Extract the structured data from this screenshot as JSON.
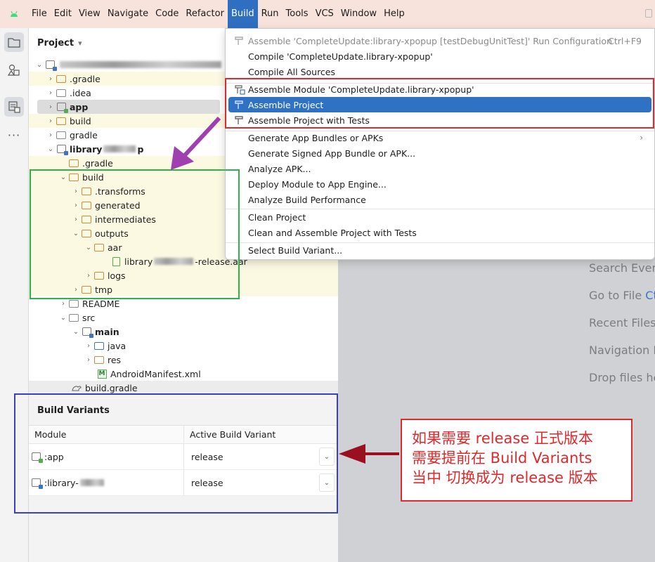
{
  "menubar": {
    "items": [
      "File",
      "Edit",
      "View",
      "Navigate",
      "Code",
      "Refactor",
      "Build",
      "Run",
      "Tools",
      "VCS",
      "Window",
      "Help"
    ],
    "active": "Build"
  },
  "project_panel": {
    "title": "Project",
    "tree": [
      {
        "label": "",
        "blurred": true
      },
      {
        "label": ".gradle"
      },
      {
        "label": ".idea"
      },
      {
        "label": "app"
      },
      {
        "label": "build"
      },
      {
        "label": "gradle"
      },
      {
        "label": "library",
        "blurred_suffix": true
      },
      {
        "label": ".gradle"
      },
      {
        "label": "build"
      },
      {
        "label": ".transforms"
      },
      {
        "label": "generated"
      },
      {
        "label": "intermediates"
      },
      {
        "label": "outputs"
      },
      {
        "label": "aar"
      },
      {
        "label": "library",
        "suffix": "-release.aar"
      },
      {
        "label": "logs"
      },
      {
        "label": "tmp"
      },
      {
        "label": "README"
      },
      {
        "label": "src"
      },
      {
        "label": "main"
      },
      {
        "label": "java"
      },
      {
        "label": "res"
      },
      {
        "label": "AndroidManifest.xml"
      },
      {
        "label": "build.gradle"
      }
    ]
  },
  "build_menu": {
    "items": [
      {
        "label": "Assemble 'CompleteUpdate:library-xpopup [testDebugUnitTest]' Run Configuration",
        "shortcut": "Ctrl+F9",
        "disabled": true
      },
      {
        "label": "Compile 'CompleteUpdate.library-xpopup'"
      },
      {
        "label": "Compile All Sources"
      },
      {
        "label": "Assemble Module 'CompleteUpdate.library-xpopup'"
      },
      {
        "label": "Assemble Project",
        "selected": true
      },
      {
        "label": "Assemble Project with Tests"
      },
      {
        "label": "Generate App Bundles or APKs",
        "submenu": true
      },
      {
        "label": "Generate Signed App Bundle or APK..."
      },
      {
        "label": "Analyze APK..."
      },
      {
        "label": "Deploy Module to App Engine..."
      },
      {
        "label": "Analyze Build Performance"
      },
      {
        "label": "Clean Project"
      },
      {
        "label": "Clean and Assemble Project with Tests"
      },
      {
        "label": "Select Build Variant..."
      }
    ]
  },
  "editor_hints": [
    "Search Every",
    "Go to File",
    "Recent Files",
    "Navigation B",
    "Drop files he"
  ],
  "editor_hint_shortcut": "Ct",
  "build_variants": {
    "title": "Build Variants",
    "columns": [
      "Module",
      "Active Build Variant"
    ],
    "rows": [
      {
        "module": ":app",
        "variant": "release"
      },
      {
        "module": ":library-",
        "variant": "release"
      }
    ]
  },
  "annotation": {
    "lines": [
      "如果需要  release 正式版本",
      "需要提前在 Build Variants",
      "当中 切换成为  release 版本"
    ]
  },
  "colors": {
    "accent": "#2f72c4",
    "red_box": "#e0292c",
    "green_box": "#2fb24a",
    "blue_box": "#3a3fc4",
    "purple_arrow": "#a040b0",
    "dark_red_arrow": "#9a1020"
  }
}
